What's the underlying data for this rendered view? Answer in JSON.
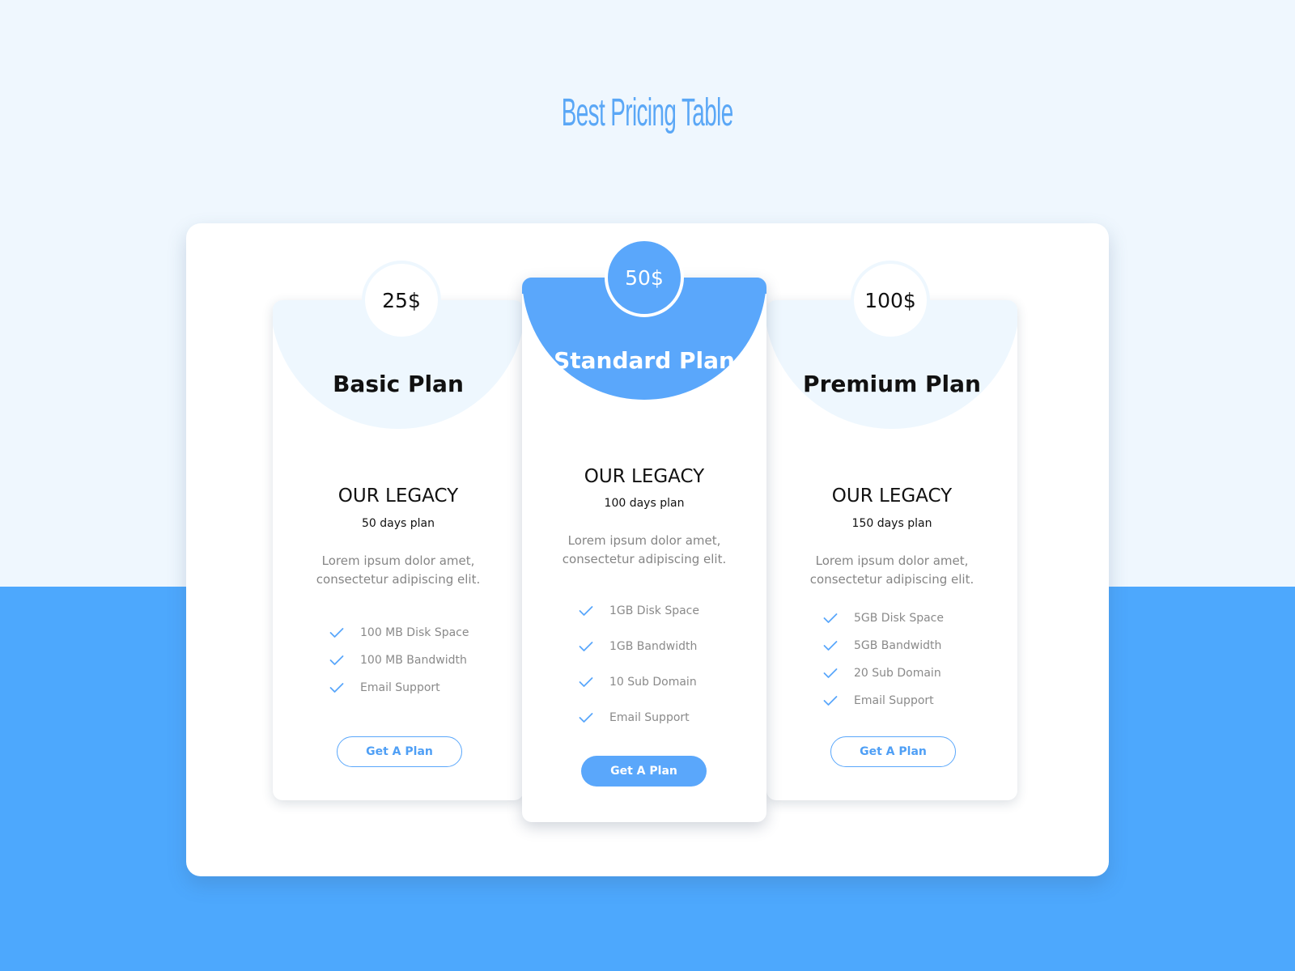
{
  "page": {
    "title": "Best Pricing Table"
  },
  "colors": {
    "accent": "#5aa7fb",
    "bottom_band": "#4da8fd",
    "top_background": "#eff7fe",
    "light_disc": "#eef7fe",
    "text_dark": "#111111",
    "text_muted": "#858585"
  },
  "plans": [
    {
      "price": "25$",
      "name": "Basic Plan",
      "legacy": "OUR LEGACY",
      "duration": "50 days plan",
      "description": "Lorem ipsum dolor amet, consectetur adipiscing elit.",
      "features": [
        "100 MB Disk Space",
        "100 MB Bandwidth",
        "Email Support"
      ],
      "button_label": "Get A Plan",
      "check_icon": "check-icon"
    },
    {
      "price": "50$",
      "name": "Standard Plan",
      "legacy": "OUR LEGACY",
      "duration": "100 days plan",
      "description": "Lorem ipsum dolor amet, consectetur adipiscing elit.",
      "features": [
        "1GB Disk Space",
        "1GB Bandwidth",
        "10 Sub Domain",
        "Email Support"
      ],
      "button_label": "Get A Plan",
      "check_icon": "check-icon"
    },
    {
      "price": "100$",
      "name": "Premium Plan",
      "legacy": "OUR LEGACY",
      "duration": "150 days plan",
      "description": "Lorem ipsum dolor amet, consectetur adipiscing elit.",
      "features": [
        "5GB Disk Space",
        "5GB Bandwidth",
        "20 Sub Domain",
        "Email Support"
      ],
      "button_label": "Get A Plan",
      "check_icon": "check-icon"
    }
  ]
}
